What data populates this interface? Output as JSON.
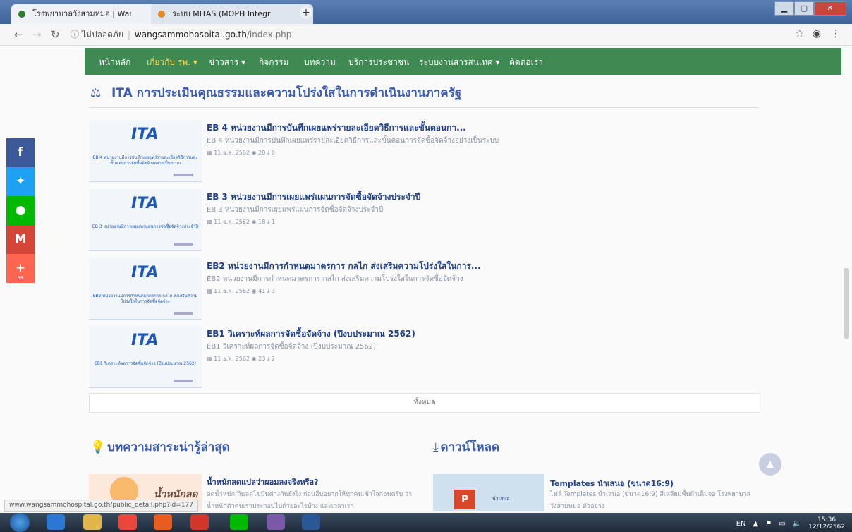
{
  "browser": {
    "tabs": [
      {
        "title": "โรงพยาบาลวังสามหมอ | Wangsam",
        "active": true
      },
      {
        "title": "ระบบ MITAS (MOPH Integrity and",
        "active": false
      }
    ],
    "address": {
      "security": "ไม่ปลอดภัย",
      "domain": "wangsammohospital.go.th",
      "path": "/index.php"
    }
  },
  "nav": {
    "items": [
      {
        "label": "หน้าหลัก"
      },
      {
        "label": "เกี่ยวกับ รพ. ▾"
      },
      {
        "label": "ข่าวสาร ▾"
      },
      {
        "label": "กิจกรรม"
      },
      {
        "label": "บทความ"
      },
      {
        "label": "บริการประชาชน"
      },
      {
        "label": "ระบบงานสารสนเทศ ▾"
      },
      {
        "label": "ติดต่อเรา"
      }
    ]
  },
  "ita": {
    "heading": "ITA การประเมินคุณธรรมและความโปร่งใสในการดำเนินงานภาครัฐ",
    "heading_icon": "scale-icon",
    "posts": [
      {
        "thumb_logo": "ITA",
        "thumb_caption": "EB 4 หน่วยงานมีการบันทึกเผยแพร่รายละเอียดวิธีการและขั้นตอนการจัดซื้อจัดจ้างอย่างเป็นระบบ",
        "title": "EB 4 หน่วยงานมีการบันทึกเผยแพร่รายละเอียดวิธีการและขั้นตอนกา...",
        "desc": "EB 4 หน่วยงานมีการบันทึกเผยแพร่รายละเอียดวิธีการและขั้นตอนการจัดซื้อจัดจ้างอย่างเป็นระบบ",
        "meta": "▦ 11 ธ.ค. 2562 ◉ 20 ⤓ 0"
      },
      {
        "thumb_logo": "ITA",
        "thumb_caption": "EB 3 หน่วยงานมีการเผยแพร่แผนการจัดซื้อจัดจ้างประจำปี",
        "title": "EB 3 หน่วยงานมีการเผยแพร่แผนการจัดซื้อจัดจ้างประจำปี",
        "desc": "EB 3 หน่วยงานมีการเผยแพร่แผนการจัดซื้อจัดจ้างประจำปี",
        "meta": "▦ 11 ธ.ค. 2562 ◉ 18 ⤓ 1"
      },
      {
        "thumb_logo": "ITA",
        "thumb_caption": "EB2 หน่วยงานมีการกำหนดมาตรการ กลไก ส่งเสริมความโปร่งใสในการจัดซื้อจัดจ้าง",
        "title": "EB2 หน่วยงานมีการกำหนดมาตรการ กลไก ส่งเสริมความโปร่งใสในการ...",
        "desc": "EB2 หน่วยงานมีการกำหนดมาตรการ กลไก ส่งเสริมความโปร่งใสในการจัดซื้อจัดจ้าง",
        "meta": "▦ 11 ธ.ค. 2562 ◉ 41 ⤓ 3"
      },
      {
        "thumb_logo": "ITA",
        "thumb_caption": "EB1 วิเคราะห์ผลการจัดซื้อจัดจ้าง (ปีงบประมาณ 2562)",
        "title": "EB1 วิเคราะห์ผลการจัดซื้อจัดจ้าง (ปีงบประมาณ 2562)",
        "desc": "EB1 วิเคราะห์ผลการจัดซื้อจัดจ้าง (ปีงบประมาณ 2562)",
        "meta": "▦ 11 ธ.ค. 2562 ◉ 23 ⤓ 2"
      }
    ],
    "all_label": "ทั้งหมด"
  },
  "social": [
    {
      "icon": "facebook-icon",
      "glyph": "f",
      "color": "#3b5998"
    },
    {
      "icon": "twitter-icon",
      "glyph": "🐦",
      "color": "#1da1f2"
    },
    {
      "icon": "line-icon",
      "glyph": "●",
      "color": "#00b900"
    },
    {
      "icon": "gmail-icon",
      "glyph": "M",
      "color": "#d44638"
    },
    {
      "icon": "share-more-icon",
      "glyph": "+",
      "color": "#ff6550",
      "count": "35"
    }
  ],
  "articles": {
    "heading": "บทความสาระน่ารู้ล่าสุด",
    "item": {
      "thumb_text": "น้ำหนักลด",
      "title": "น้ำหนักลดแปลว่าผอมลงจริงหรือ?",
      "desc": "ลดน้ำหนัก กินลดไขมันต่างกันยังไง ก่อนอื่นอยากให้ทุกคนเข้าใจก่อนครับ ว่าน้ำหนักตัวคนเราประกอบไปด้วยอะไรบ้าง และเวลาเรา"
    }
  },
  "downloads": {
    "heading": "ดาวน์โหลด",
    "item": {
      "thumb_label": "นำเสนอ",
      "title": "Templates นำเสนอ (ขนาด16:9)",
      "desc": "ไฟล์ Templates นำเสนอ (ขนาด16:9) สีเหลี่ยมพื้นผ้าเต็มจอ โรงพยาบาลวังสามหมอ ตัวอย่าง"
    }
  },
  "status_url": "www.wangsammohospital.go.th/public_detail.php?id=177",
  "taskbar": {
    "lang": "EN",
    "time": "15:36",
    "date": "12/12/2562"
  },
  "colors": {
    "nav_green": "#3f8a52",
    "heading_blue": "#3a5bb0",
    "title_blue": "#1f3f8a"
  }
}
